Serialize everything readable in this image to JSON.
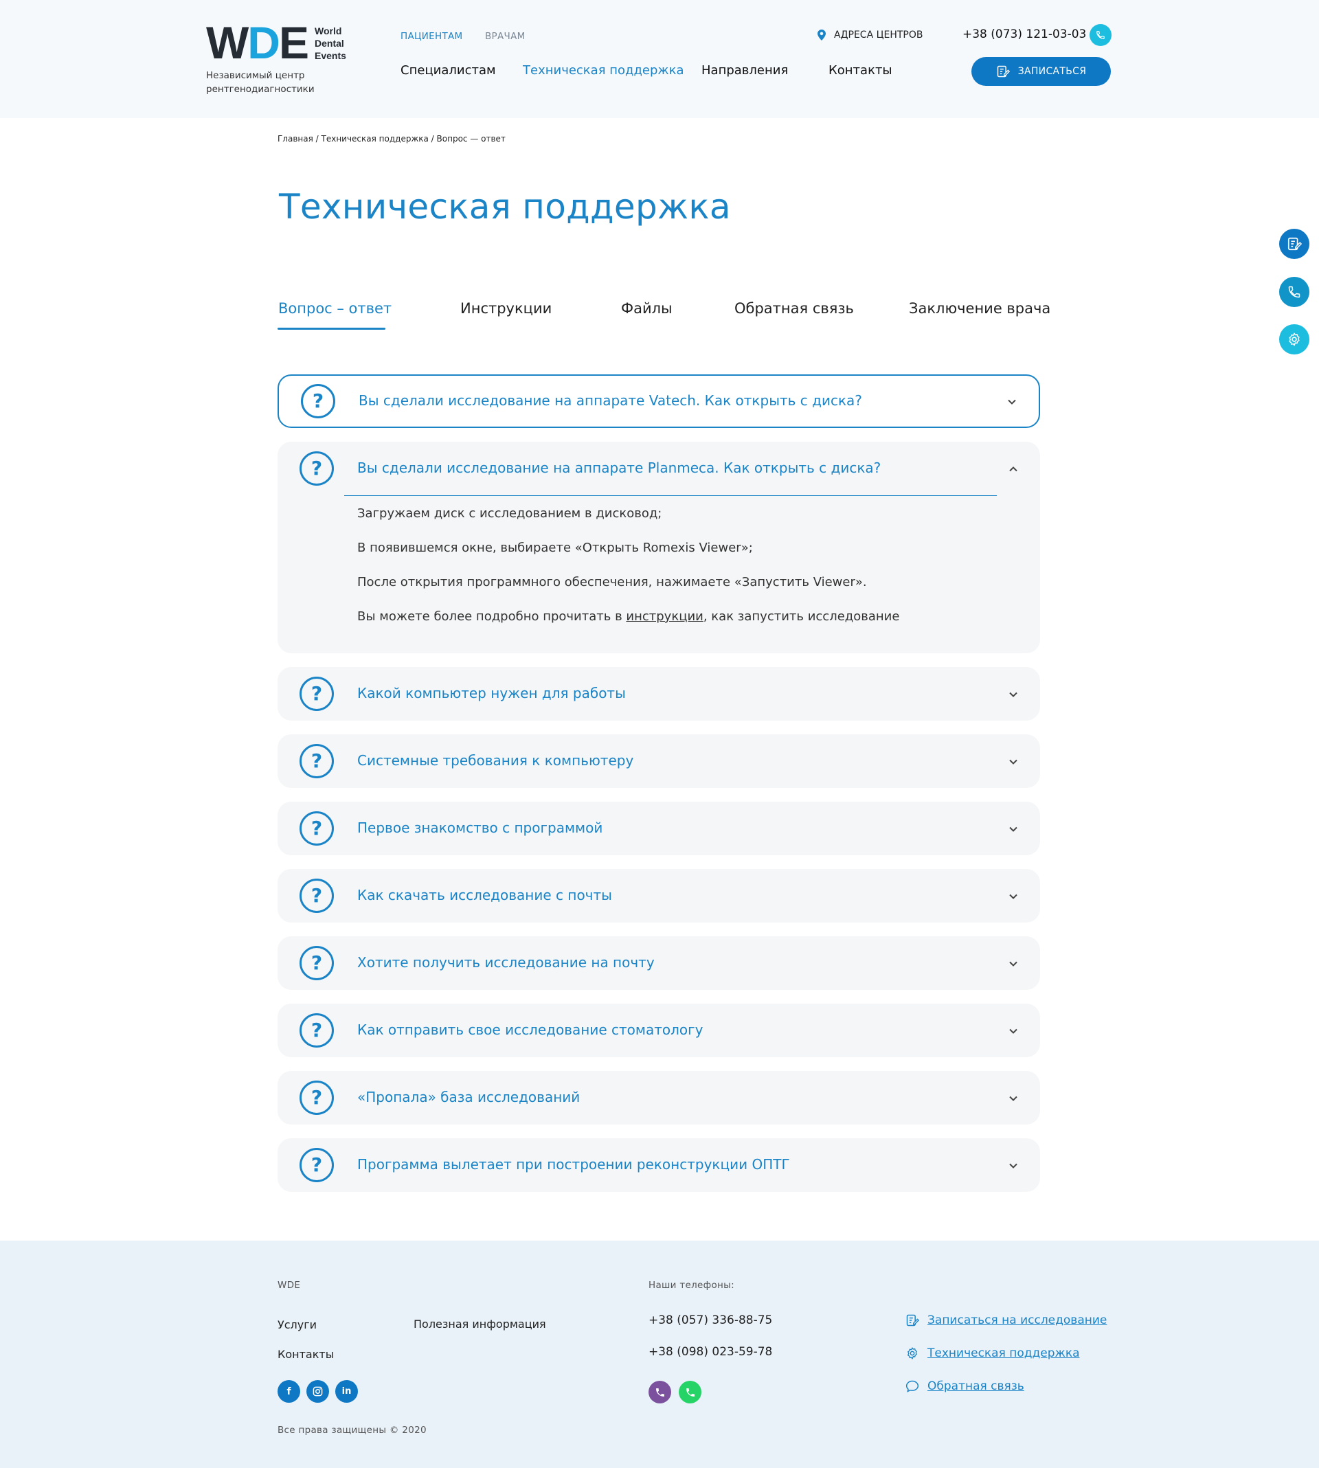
{
  "header": {
    "logo": {
      "text_w": "W",
      "text_d": "D",
      "text_e": "E",
      "sub_lines": [
        "World",
        "Dental",
        "Events"
      ],
      "tagline": "Независимый центр рентгенодиагностики"
    },
    "top_links": [
      "ПАЦИЕНТАМ",
      "ВРАЧАМ"
    ],
    "nav": [
      "Специалистам",
      "Техническая поддержка",
      "Направления",
      "Контакты"
    ],
    "address_label": "АДРЕСА ЦЕНТРОВ",
    "phone": "+38 (073) 121-03-03",
    "signup_label": "ЗАПИСАТЬСЯ"
  },
  "breadcrumb": "Главная / Техническая поддержка / Вопрос — ответ",
  "page_title": "Техническая поддержка",
  "tabs": [
    "Вопрос – ответ",
    "Инструкции",
    "Файлы",
    "Обратная связь",
    "Заключение врача"
  ],
  "faq": {
    "icon": "?",
    "items": [
      "Вы сделали исследование на аппарате Vatech. Как открыть с диска?",
      "Вы сделали исследование на аппарате Planmeca. Как открыть с диска?",
      "Какой компьютер нужен для работы",
      "Системные требования к компьютеру",
      "Первое знакомство с программой",
      "Как скачать исследование с почты",
      "Хотите получить исследование на почту",
      "Как отправить свое исследование стоматологу",
      "«Пропала» база исследований",
      "Программа вылетает при построении реконструкции ОПТГ"
    ],
    "expanded_answer": {
      "line1": "Загружаем диск с исследованием в дисковод;",
      "line2": "В появившемся окне, выбираете «Открыть Romexis Viewer»;",
      "line3": "После открытия программного обеспечения, нажимаете «Запустить Viewer».",
      "line4_pre": "Вы можете более подробно прочитать в ",
      "line4_link": "инструкции",
      "line4_post": ", как запустить исследование"
    }
  },
  "footer": {
    "brand": "WDE",
    "links": [
      "Услуги",
      "Полезная информация",
      "Контакты"
    ],
    "phones_label": "Наши телефоны:",
    "phones": [
      "+38 (057) 336-88-75",
      "+38 (098) 023-59-78"
    ],
    "actions": [
      "Записаться на исследование",
      "Техническая поддержка",
      "Обратная связь"
    ],
    "social": [
      "f",
      "in"
    ],
    "copyright": "Все права защищены © 2020"
  },
  "colors": {
    "accent": "#1a84c7",
    "button": "#0f78c4",
    "light_blue": "#1dbde0",
    "viber": "#7b519d",
    "whatsapp": "#25d366"
  }
}
